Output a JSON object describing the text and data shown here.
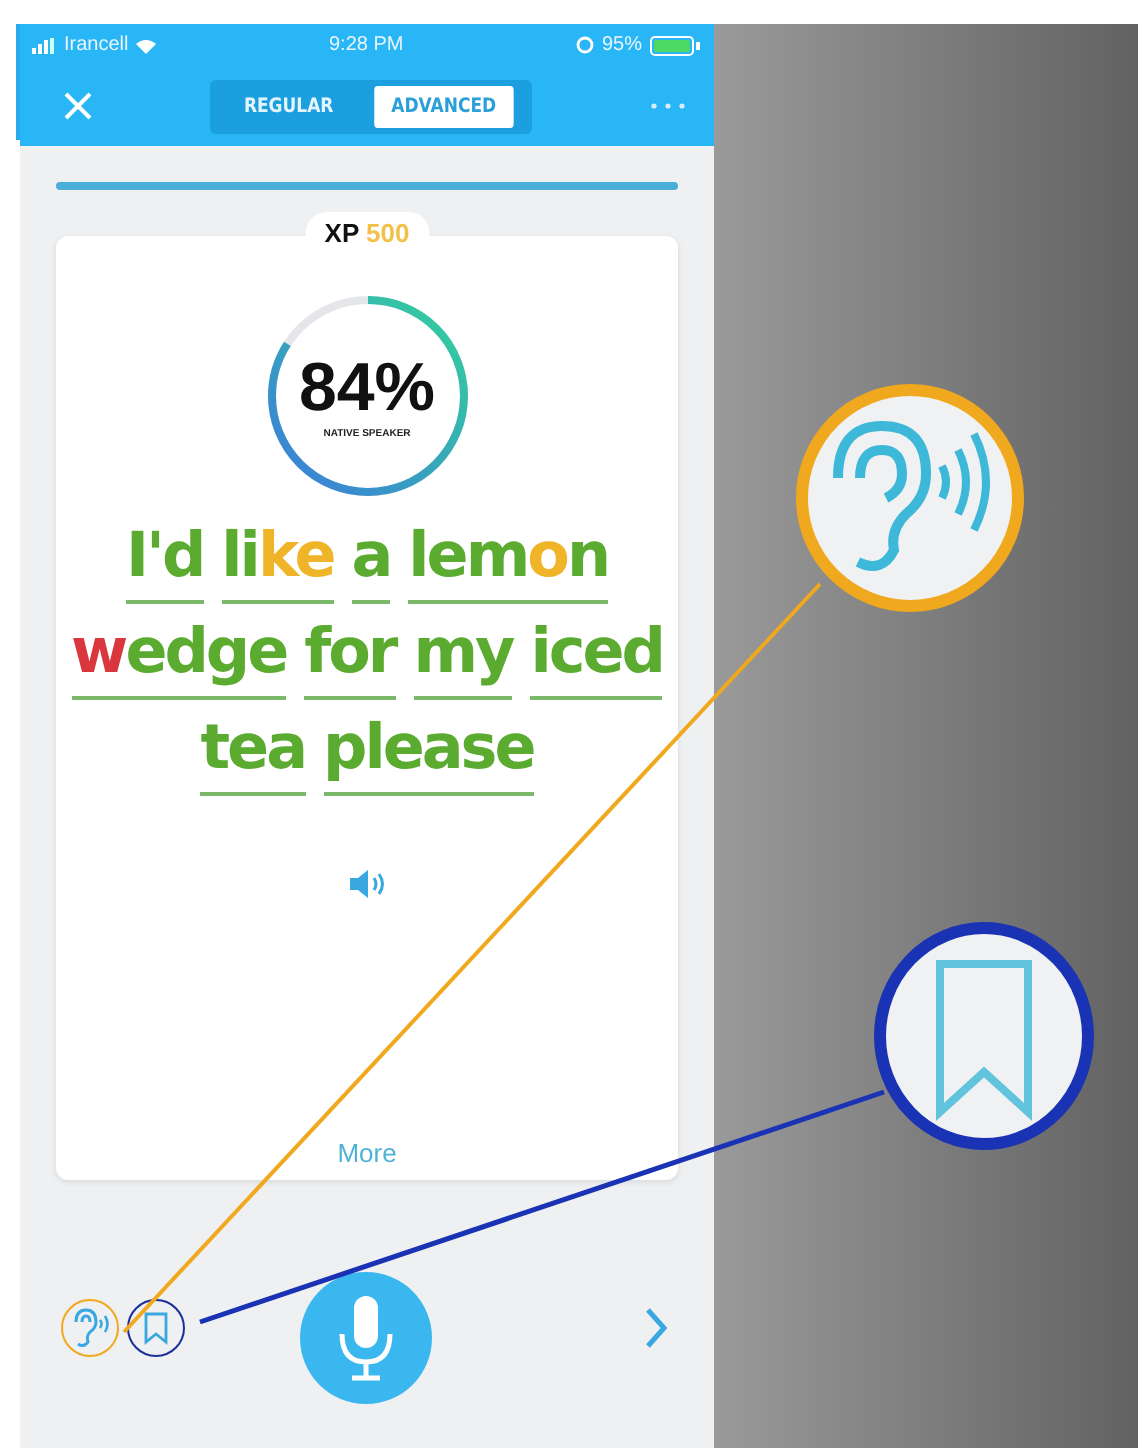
{
  "status_bar": {
    "carrier": "Irancell",
    "time": "9:28 PM",
    "battery": "95%"
  },
  "tabs": [
    {
      "label": "REGULAR",
      "selected": false
    },
    {
      "label": "ADVANCED",
      "selected": true
    }
  ],
  "lesson_progress": {
    "level": 1
  },
  "xp": {
    "label": "XP",
    "value": "500"
  },
  "score": {
    "value": "84%",
    "caption": "NATIVE SPEAKER",
    "level": 0.84
  },
  "sentence": [
    {
      "segments": [
        {
          "text": "I'd",
          "color": "#5aab2f"
        }
      ]
    },
    {
      "segments": [
        {
          "text": "li",
          "color": "#5aab2f"
        },
        {
          "text": "ke",
          "color": "#f0b429"
        }
      ]
    },
    {
      "segments": [
        {
          "text": "a",
          "color": "#5aab2f"
        }
      ]
    },
    {
      "segments": [
        {
          "text": "lem",
          "color": "#5aab2f"
        },
        {
          "text": "o",
          "color": "#f0b429"
        },
        {
          "text": "n",
          "color": "#5aab2f"
        }
      ]
    },
    {
      "segments": [
        {
          "text": "w",
          "color": "#d9363e"
        },
        {
          "text": "edge",
          "color": "#5aab2f"
        }
      ]
    },
    {
      "segments": [
        {
          "text": "for",
          "color": "#5aab2f"
        }
      ]
    },
    {
      "segments": [
        {
          "text": "my",
          "color": "#5aab2f"
        }
      ]
    },
    {
      "segments": [
        {
          "text": "iced",
          "color": "#5aab2f"
        }
      ]
    },
    {
      "segments": [
        {
          "text": "tea",
          "color": "#5aab2f"
        }
      ]
    },
    {
      "segments": [
        {
          "text": "please",
          "color": "#5aab2f"
        }
      ]
    }
  ],
  "more_link": "More"
}
